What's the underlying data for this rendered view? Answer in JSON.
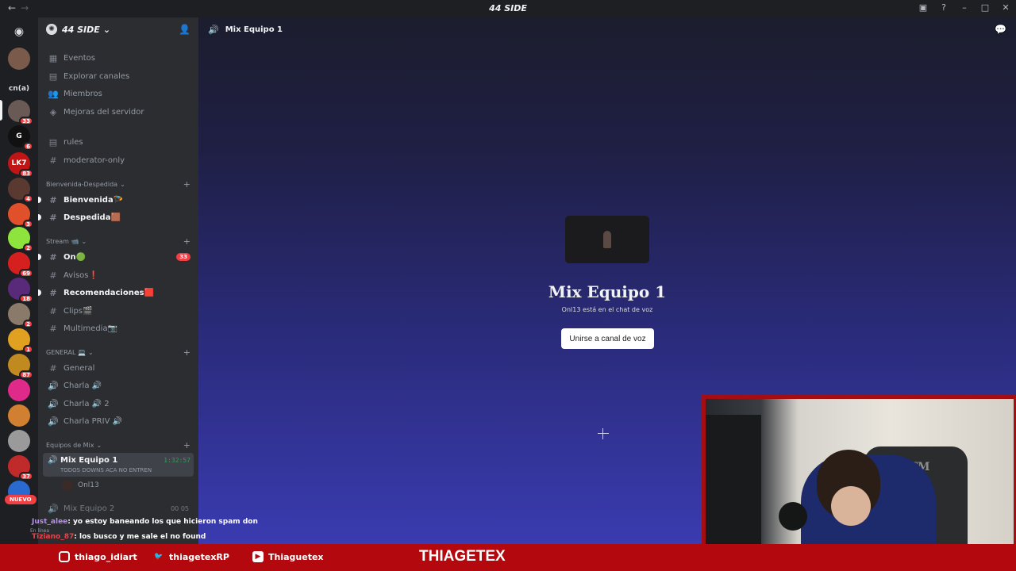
{
  "window": {
    "title": "44 SIDE",
    "back": "←",
    "forward": "→"
  },
  "server": {
    "name": "44 SIDE"
  },
  "guilds": [
    {
      "label": "",
      "color": "#5865f2",
      "badge": ""
    },
    {
      "label": "",
      "color": "#7a5a4a",
      "badge": ""
    },
    {
      "label": "cn(a)",
      "color": "transparent",
      "badge": ""
    },
    {
      "label": "",
      "color": "#6a5a55",
      "badge": "33"
    },
    {
      "label": "G",
      "color": "#111",
      "badge": "6"
    },
    {
      "label": "LK7",
      "color": "#c01515",
      "badge": "83"
    },
    {
      "label": "",
      "color": "#5a3a30",
      "badge": "4"
    },
    {
      "label": "",
      "color": "#e0502a",
      "badge": "3"
    },
    {
      "label": "",
      "color": "#8ee33c",
      "badge": "2"
    },
    {
      "label": "",
      "color": "#d62020",
      "badge": "69"
    },
    {
      "label": "",
      "color": "#5a2a7a",
      "badge": "18"
    },
    {
      "label": "",
      "color": "#8a7a6a",
      "badge": "2"
    },
    {
      "label": "",
      "color": "#e0a020",
      "badge": "1"
    },
    {
      "label": "",
      "color": "#c08a20",
      "badge": "87"
    },
    {
      "label": "",
      "color": "#e02a8a",
      "badge": ""
    },
    {
      "label": "",
      "color": "#d08030",
      "badge": ""
    },
    {
      "label": "",
      "color": "#9a9a9a",
      "badge": ""
    },
    {
      "label": "",
      "color": "#c02a2a",
      "badge": "37"
    },
    {
      "label": "",
      "color": "#2a6ad0",
      "badge": ""
    }
  ],
  "menu": [
    {
      "icon": "▦",
      "label": "Eventos"
    },
    {
      "icon": "▤",
      "label": "Explorar canales"
    },
    {
      "icon": "👥",
      "label": "Miembros"
    },
    {
      "icon": "◈",
      "label": "Mejoras del servidor"
    }
  ],
  "top_channels": [
    {
      "icon": "▤",
      "label": "rules",
      "unread": false
    },
    {
      "icon": "#",
      "label": "moderator-only",
      "unread": false
    }
  ],
  "categories": {
    "bienvenida": "Bienvenida-Despedida",
    "stream": "Stream 📹",
    "general": "GENERAL 💻",
    "equipos": "Equipos de Mix"
  },
  "bienvenida_channels": [
    {
      "icon": "#",
      "label": "Bienvenida🪂",
      "unread": true
    },
    {
      "icon": "#",
      "label": "Despedida🟫",
      "unread": true
    }
  ],
  "stream_channels": [
    {
      "icon": "#",
      "label": "On🟢",
      "unread": true,
      "count": "33"
    },
    {
      "icon": "#",
      "label": "Avisos❗",
      "unread": false,
      "count": ""
    },
    {
      "icon": "#",
      "label": "Recomendaciones🟥",
      "unread": true,
      "count": ""
    },
    {
      "icon": "#",
      "label": "Clips🎬",
      "unread": false,
      "count": ""
    },
    {
      "icon": "#",
      "label": "Multimedia📷",
      "unread": false,
      "count": ""
    }
  ],
  "general_channels": [
    {
      "icon": "#",
      "label": "General"
    },
    {
      "icon": "🔊",
      "label": "Charla 🔊"
    },
    {
      "icon": "🔊",
      "label": "Charla 🔊 2"
    },
    {
      "icon": "🔊",
      "label": "Charla PRIV 🔊"
    }
  ],
  "active_voice": {
    "name": "Mix Equipo 1",
    "timer": "1:32:57",
    "status": "TODOS DOWNS ACA NO ENTREN",
    "user": "Onl13"
  },
  "next_voice": {
    "name": "Mix Equipo 2",
    "counts": "00  05"
  },
  "main": {
    "header": "Mix Equipo 1",
    "title": "Mix Equipo 1",
    "subtitle": "Onl13 está en el chat de voz",
    "join_button": "Unirse a canal de voz"
  },
  "overlay": {
    "nuevo": "NUEVO",
    "online": "En línea",
    "chat": [
      {
        "user": "Just_alee",
        "text": ": yo estoy baneando los que hicieron spam don"
      },
      {
        "user": "Tiziano_87",
        "text": ": los busco y me sale el no found"
      }
    ]
  },
  "webcam": {
    "chair_text": "JTM"
  },
  "bottom_bar": {
    "instagram": "thiago_idiart",
    "twitter": "thiagetexRP",
    "youtube": "Thiaguetex",
    "brand": "THIAGETEX"
  },
  "colors": {
    "accent": "#5865f2",
    "stream_red": "#b3090e",
    "voice_green": "#23a55a"
  }
}
